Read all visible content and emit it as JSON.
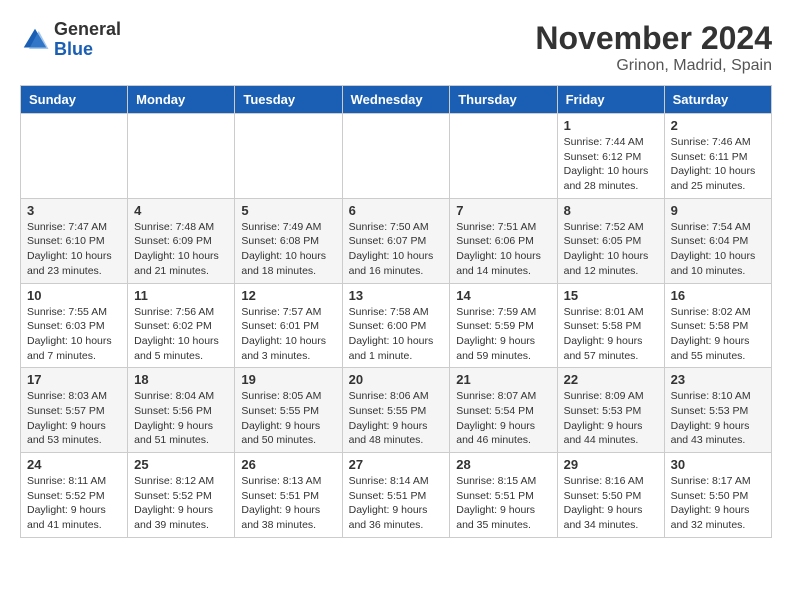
{
  "header": {
    "logo_general": "General",
    "logo_blue": "Blue",
    "month_title": "November 2024",
    "location": "Grinon, Madrid, Spain"
  },
  "calendar": {
    "headers": [
      "Sunday",
      "Monday",
      "Tuesday",
      "Wednesday",
      "Thursday",
      "Friday",
      "Saturday"
    ],
    "weeks": [
      {
        "days": [
          {
            "number": "",
            "info": ""
          },
          {
            "number": "",
            "info": ""
          },
          {
            "number": "",
            "info": ""
          },
          {
            "number": "",
            "info": ""
          },
          {
            "number": "",
            "info": ""
          },
          {
            "number": "1",
            "info": "Sunrise: 7:44 AM\nSunset: 6:12 PM\nDaylight: 10 hours\nand 28 minutes."
          },
          {
            "number": "2",
            "info": "Sunrise: 7:46 AM\nSunset: 6:11 PM\nDaylight: 10 hours\nand 25 minutes."
          }
        ]
      },
      {
        "days": [
          {
            "number": "3",
            "info": "Sunrise: 7:47 AM\nSunset: 6:10 PM\nDaylight: 10 hours\nand 23 minutes."
          },
          {
            "number": "4",
            "info": "Sunrise: 7:48 AM\nSunset: 6:09 PM\nDaylight: 10 hours\nand 21 minutes."
          },
          {
            "number": "5",
            "info": "Sunrise: 7:49 AM\nSunset: 6:08 PM\nDaylight: 10 hours\nand 18 minutes."
          },
          {
            "number": "6",
            "info": "Sunrise: 7:50 AM\nSunset: 6:07 PM\nDaylight: 10 hours\nand 16 minutes."
          },
          {
            "number": "7",
            "info": "Sunrise: 7:51 AM\nSunset: 6:06 PM\nDaylight: 10 hours\nand 14 minutes."
          },
          {
            "number": "8",
            "info": "Sunrise: 7:52 AM\nSunset: 6:05 PM\nDaylight: 10 hours\nand 12 minutes."
          },
          {
            "number": "9",
            "info": "Sunrise: 7:54 AM\nSunset: 6:04 PM\nDaylight: 10 hours\nand 10 minutes."
          }
        ]
      },
      {
        "days": [
          {
            "number": "10",
            "info": "Sunrise: 7:55 AM\nSunset: 6:03 PM\nDaylight: 10 hours\nand 7 minutes."
          },
          {
            "number": "11",
            "info": "Sunrise: 7:56 AM\nSunset: 6:02 PM\nDaylight: 10 hours\nand 5 minutes."
          },
          {
            "number": "12",
            "info": "Sunrise: 7:57 AM\nSunset: 6:01 PM\nDaylight: 10 hours\nand 3 minutes."
          },
          {
            "number": "13",
            "info": "Sunrise: 7:58 AM\nSunset: 6:00 PM\nDaylight: 10 hours\nand 1 minute."
          },
          {
            "number": "14",
            "info": "Sunrise: 7:59 AM\nSunset: 5:59 PM\nDaylight: 9 hours\nand 59 minutes."
          },
          {
            "number": "15",
            "info": "Sunrise: 8:01 AM\nSunset: 5:58 PM\nDaylight: 9 hours\nand 57 minutes."
          },
          {
            "number": "16",
            "info": "Sunrise: 8:02 AM\nSunset: 5:58 PM\nDaylight: 9 hours\nand 55 minutes."
          }
        ]
      },
      {
        "days": [
          {
            "number": "17",
            "info": "Sunrise: 8:03 AM\nSunset: 5:57 PM\nDaylight: 9 hours\nand 53 minutes."
          },
          {
            "number": "18",
            "info": "Sunrise: 8:04 AM\nSunset: 5:56 PM\nDaylight: 9 hours\nand 51 minutes."
          },
          {
            "number": "19",
            "info": "Sunrise: 8:05 AM\nSunset: 5:55 PM\nDaylight: 9 hours\nand 50 minutes."
          },
          {
            "number": "20",
            "info": "Sunrise: 8:06 AM\nSunset: 5:55 PM\nDaylight: 9 hours\nand 48 minutes."
          },
          {
            "number": "21",
            "info": "Sunrise: 8:07 AM\nSunset: 5:54 PM\nDaylight: 9 hours\nand 46 minutes."
          },
          {
            "number": "22",
            "info": "Sunrise: 8:09 AM\nSunset: 5:53 PM\nDaylight: 9 hours\nand 44 minutes."
          },
          {
            "number": "23",
            "info": "Sunrise: 8:10 AM\nSunset: 5:53 PM\nDaylight: 9 hours\nand 43 minutes."
          }
        ]
      },
      {
        "days": [
          {
            "number": "24",
            "info": "Sunrise: 8:11 AM\nSunset: 5:52 PM\nDaylight: 9 hours\nand 41 minutes."
          },
          {
            "number": "25",
            "info": "Sunrise: 8:12 AM\nSunset: 5:52 PM\nDaylight: 9 hours\nand 39 minutes."
          },
          {
            "number": "26",
            "info": "Sunrise: 8:13 AM\nSunset: 5:51 PM\nDaylight: 9 hours\nand 38 minutes."
          },
          {
            "number": "27",
            "info": "Sunrise: 8:14 AM\nSunset: 5:51 PM\nDaylight: 9 hours\nand 36 minutes."
          },
          {
            "number": "28",
            "info": "Sunrise: 8:15 AM\nSunset: 5:51 PM\nDaylight: 9 hours\nand 35 minutes."
          },
          {
            "number": "29",
            "info": "Sunrise: 8:16 AM\nSunset: 5:50 PM\nDaylight: 9 hours\nand 34 minutes."
          },
          {
            "number": "30",
            "info": "Sunrise: 8:17 AM\nSunset: 5:50 PM\nDaylight: 9 hours\nand 32 minutes."
          }
        ]
      }
    ]
  }
}
